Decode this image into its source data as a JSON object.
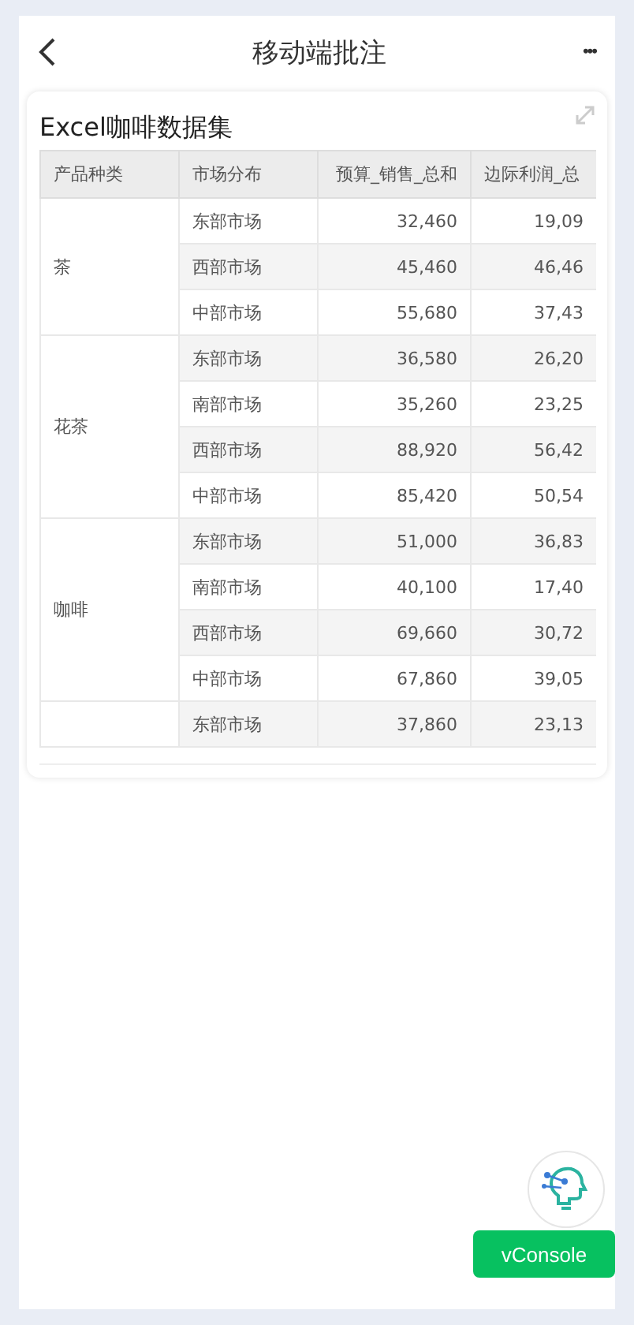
{
  "header": {
    "title": "移动端批注",
    "more": "•••"
  },
  "card": {
    "title": "Excel咖啡数据集",
    "table": {
      "columns": [
        "产品种类",
        "市场分布",
        "预算_销售_总和",
        "边际利润_总"
      ],
      "groups": [
        {
          "product": "茶",
          "rows": [
            [
              "东部市场",
              "32,460",
              "19,09"
            ],
            [
              "西部市场",
              "45,460",
              "46,46"
            ],
            [
              "中部市场",
              "55,680",
              "37,43"
            ]
          ]
        },
        {
          "product": "花茶",
          "rows": [
            [
              "东部市场",
              "36,580",
              "26,20"
            ],
            [
              "南部市场",
              "35,260",
              "23,25"
            ],
            [
              "西部市场",
              "88,920",
              "56,42"
            ],
            [
              "中部市场",
              "85,420",
              "50,54"
            ]
          ]
        },
        {
          "product": "咖啡",
          "rows": [
            [
              "东部市场",
              "51,000",
              "36,83"
            ],
            [
              "南部市场",
              "40,100",
              "17,40"
            ],
            [
              "西部市场",
              "69,660",
              "30,72"
            ],
            [
              "中部市场",
              "67,860",
              "39,05"
            ]
          ]
        },
        {
          "rows": [
            [
              "东部市场",
              "37,860",
              "23,13"
            ]
          ]
        }
      ]
    }
  },
  "vconsole": "vConsole"
}
